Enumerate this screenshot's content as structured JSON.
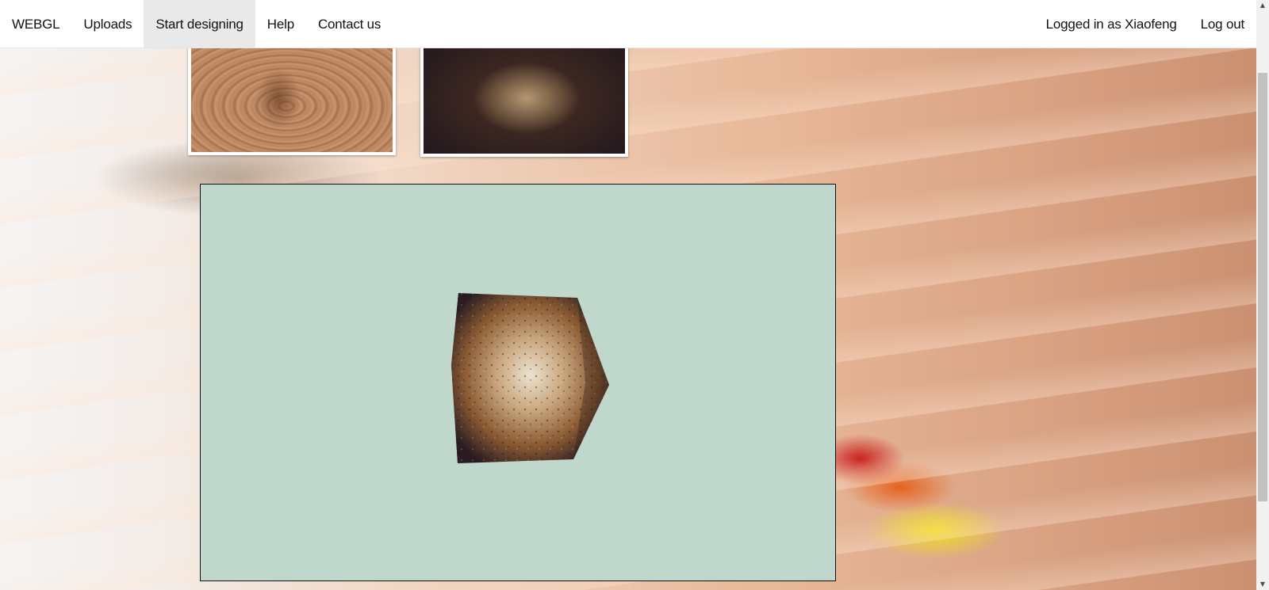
{
  "navbar": {
    "brand": "WEBGL",
    "items": [
      {
        "label": "Uploads"
      },
      {
        "label": "Start designing"
      },
      {
        "label": "Help"
      },
      {
        "label": "Contact us"
      }
    ],
    "right_items": [
      {
        "label": "Logged in as Xiaofeng"
      },
      {
        "label": "Log out"
      }
    ],
    "active_item": "Start designing"
  },
  "textures": [
    {
      "name": "light wood texture"
    },
    {
      "name": "dark grunge wood texture"
    }
  ],
  "viewer": {
    "background_color": "#bfd8cb",
    "object": "textured cube"
  },
  "scrollbar": {
    "up_arrow": "▲",
    "down_arrow": "▼"
  },
  "colors": {
    "navbar_bg": "#ffffff",
    "active_nav_bg": "#e9e9e9",
    "canvas_bg": "#bfd8cb"
  }
}
